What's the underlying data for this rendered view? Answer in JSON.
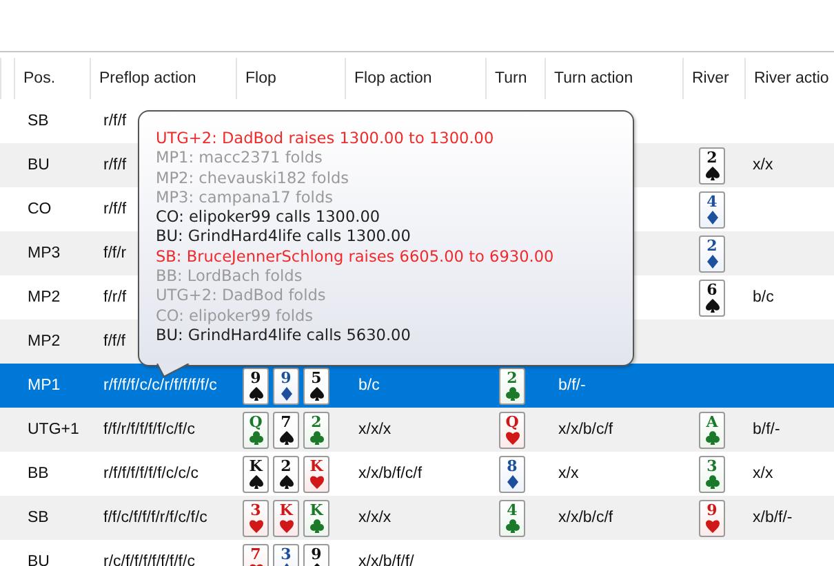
{
  "columns": [
    "Pos.",
    "Preflop action",
    "Flop",
    "Flop action",
    "Turn",
    "Turn action",
    "River",
    "River actio"
  ],
  "rows": [
    {
      "pos": "SB",
      "preflop": "r/f/f",
      "selected": false
    },
    {
      "pos": "BU",
      "preflop": "r/f/f",
      "river": {
        "rank": "2",
        "kind": "spades"
      },
      "river_action": "x/x",
      "selected": false
    },
    {
      "pos": "CO",
      "preflop": "r/f/f",
      "river": {
        "rank": "4",
        "kind": "diamonds"
      },
      "selected": false
    },
    {
      "pos": "MP3",
      "preflop": "f/f/r",
      "river": {
        "rank": "2",
        "kind": "diamonds"
      },
      "selected": false
    },
    {
      "pos": "MP2",
      "preflop": "f/r/f",
      "river": {
        "rank": "6",
        "kind": "spades"
      },
      "river_action": "b/c",
      "selected": false
    },
    {
      "pos": "MP2",
      "preflop": "f/f/f",
      "selected": false
    },
    {
      "pos": "MP1",
      "preflop": "r/f/f/f/c/c/r/f/f/f/f/c",
      "flop": [
        {
          "rank": "9",
          "kind": "spades"
        },
        {
          "rank": "9",
          "kind": "diamonds"
        },
        {
          "rank": "5",
          "kind": "spades"
        }
      ],
      "flop_action": "b/c",
      "turn": {
        "rank": "2",
        "kind": "clubs"
      },
      "turn_action": "b/f/-",
      "selected": true
    },
    {
      "pos": "UTG+1",
      "preflop": "f/f/r/f/f/f/f/c/f/c",
      "flop": [
        {
          "rank": "Q",
          "kind": "clubs"
        },
        {
          "rank": "7",
          "kind": "spades"
        },
        {
          "rank": "2",
          "kind": "clubs"
        }
      ],
      "flop_action": "x/x/x",
      "turn": {
        "rank": "Q",
        "kind": "hearts"
      },
      "turn_action": "x/x/b/c/f",
      "river": {
        "rank": "A",
        "kind": "clubs"
      },
      "river_action": "b/f/-",
      "selected": false
    },
    {
      "pos": "BB",
      "preflop": "r/f/f/f/f/f/f/c/c/c",
      "flop": [
        {
          "rank": "K",
          "kind": "spades"
        },
        {
          "rank": "2",
          "kind": "spades"
        },
        {
          "rank": "K",
          "kind": "hearts"
        }
      ],
      "flop_action": "x/x/b/f/c/f",
      "turn": {
        "rank": "8",
        "kind": "diamonds"
      },
      "turn_action": "x/x",
      "river": {
        "rank": "3",
        "kind": "clubs"
      },
      "river_action": "x/x",
      "selected": false
    },
    {
      "pos": "SB",
      "preflop": "f/f/c/f/f/f/r/f/c/f/c",
      "flop": [
        {
          "rank": "3",
          "kind": "hearts"
        },
        {
          "rank": "K",
          "kind": "hearts"
        },
        {
          "rank": "K",
          "kind": "clubs"
        }
      ],
      "flop_action": "x/x/x",
      "turn": {
        "rank": "4",
        "kind": "clubs"
      },
      "turn_action": "x/x/b/c/f",
      "river": {
        "rank": "9",
        "kind": "hearts"
      },
      "river_action": "x/b/f/-",
      "selected": false
    },
    {
      "pos": "BU",
      "preflop": "r/c/f/f/f/f/f/f/f/c",
      "flop": [
        {
          "rank": "7",
          "kind": "hearts"
        },
        {
          "rank": "3",
          "kind": "diamonds"
        },
        {
          "rank": "9",
          "kind": "spades"
        }
      ],
      "flop_action": "x/x/b/f/f/",
      "selected": false
    }
  ],
  "tooltip": {
    "lines": [
      {
        "text": "UTG+2: DadBod raises 1300.00 to 1300.00",
        "kind": "raise"
      },
      {
        "text": "MP1: macc2371 folds",
        "kind": "fold"
      },
      {
        "text": "MP2: chevauski182 folds",
        "kind": "fold"
      },
      {
        "text": "MP3: campana17 folds",
        "kind": "fold"
      },
      {
        "text": "CO: elipoker99 calls 1300.00",
        "kind": "call"
      },
      {
        "text": "BU: GrindHard4life calls 1300.00",
        "kind": "call"
      },
      {
        "text": "SB: BruceJennerSchlong raises 6605.00 to 6930.00",
        "kind": "raise"
      },
      {
        "text": "BB: LordBach folds",
        "kind": "fold"
      },
      {
        "text": "UTG+2: DadBod folds",
        "kind": "fold"
      },
      {
        "text": "CO: elipoker99 folds",
        "kind": "fold"
      },
      {
        "text": "BU: GrindHard4life calls 5630.00",
        "kind": "call"
      }
    ]
  }
}
